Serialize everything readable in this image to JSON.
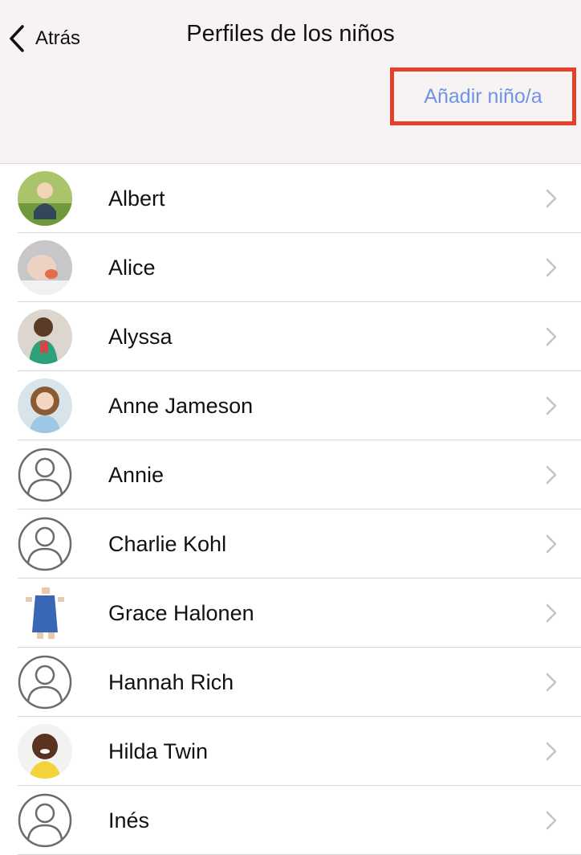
{
  "header": {
    "back_label": "Atrás",
    "title": "Perfiles de los niños",
    "add_label": "Añadir niño/a"
  },
  "children": [
    {
      "name": "Albert",
      "avatar": "photo"
    },
    {
      "name": "Alice",
      "avatar": "photo"
    },
    {
      "name": "Alyssa",
      "avatar": "photo"
    },
    {
      "name": "Anne Jameson",
      "avatar": "photo"
    },
    {
      "name": "Annie",
      "avatar": "placeholder"
    },
    {
      "name": "Charlie Kohl",
      "avatar": "placeholder"
    },
    {
      "name": "Grace Halonen",
      "avatar": "photo"
    },
    {
      "name": "Hannah Rich",
      "avatar": "placeholder"
    },
    {
      "name": "Hilda Twin",
      "avatar": "photo"
    },
    {
      "name": "Inés",
      "avatar": "placeholder"
    }
  ],
  "colors": {
    "header_bg": "#f7f3f2",
    "accent": "#6f94e6",
    "highlight": "#e3402b"
  }
}
